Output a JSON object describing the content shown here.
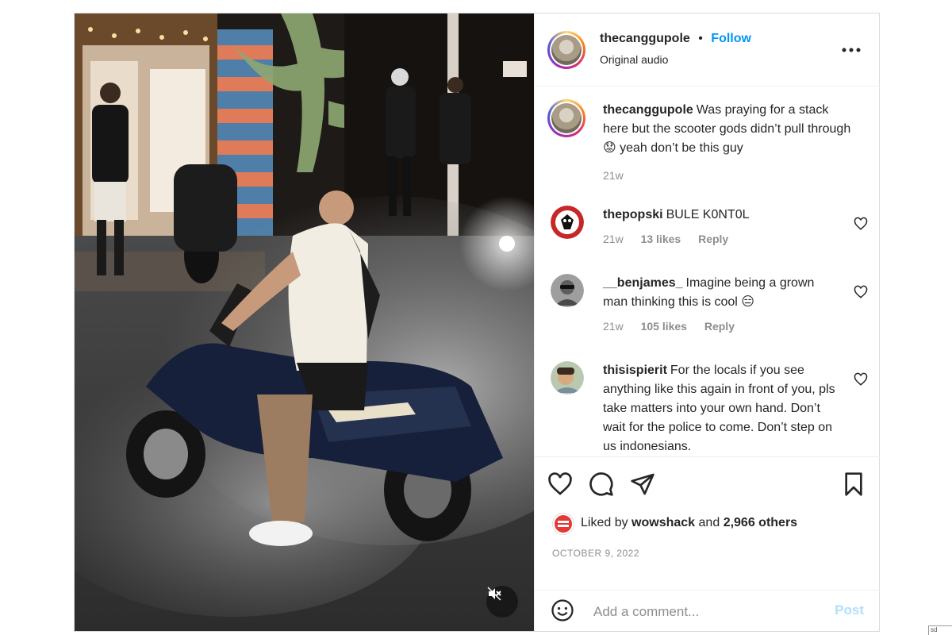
{
  "post": {
    "author": {
      "username": "thecanggupole",
      "separator": "•",
      "follow_label": "Follow",
      "audio_label": "Original audio",
      "more_icon": "more-horizontal-icon"
    },
    "caption": {
      "username": "thecanggupole",
      "text": "Was praying for a stack here but the scooter gods didn’t pull through😟 yeah don’t be this guy",
      "time": "21w"
    },
    "comments": [
      {
        "username": "thepopski",
        "text": "BULE K0NT0L",
        "time": "21w",
        "likes": "13 likes",
        "reply": "Reply"
      },
      {
        "username": "__benjames_",
        "text": "Imagine being a grown man thinking this is cool 😑",
        "time": "21w",
        "likes": "105 likes",
        "reply": "Reply"
      },
      {
        "username": "thisispierit",
        "text": "For the locals if you see anything like this again in front of you, pls take matters into your own hand. Don’t wait for the police to come. Don’t step on us indonesians.",
        "time": "",
        "likes": "",
        "reply": ""
      }
    ],
    "liked_by": {
      "prefix": "Liked by",
      "user": "wowshack",
      "joiner": "and",
      "others": "2,966 others"
    },
    "date": "OCTOBER 9, 2022",
    "comment_box": {
      "placeholder": "Add a comment...",
      "post_label": "Post",
      "emoji_icon": "smiley-icon"
    },
    "media": {
      "mute_icon": "speaker-muted-icon"
    },
    "colors": {
      "accent": "#0095f6",
      "post_disabled": "#b2dffc",
      "muted_text": "#8e8e8e"
    }
  },
  "corner_label": "sd"
}
